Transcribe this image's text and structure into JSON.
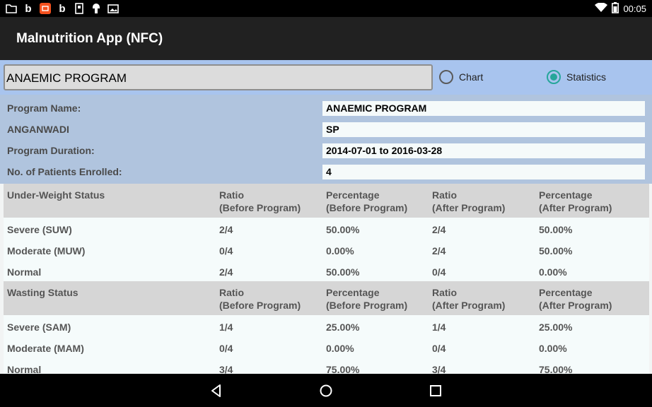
{
  "status_bar": {
    "left_icons": [
      "folder-icon",
      "b-app-icon",
      "notification-app-icon",
      "b-app-icon",
      "sim-icon",
      "android-debug-icon",
      "photos-icon"
    ],
    "time": "00:05",
    "right_icons": [
      "wifi-icon",
      "battery-icon"
    ]
  },
  "app_bar": {
    "title": "Malnutrition App (NFC)"
  },
  "controls": {
    "program_value": "ANAEMIC PROGRAM",
    "radio_chart": "Chart",
    "radio_statistics": "Statistics",
    "selected": "Statistics",
    "accent_color": "#26a69a"
  },
  "info": [
    {
      "label": "Program Name:",
      "value": "ANAEMIC PROGRAM"
    },
    {
      "label": "ANGANWADI",
      "value": "SP"
    },
    {
      "label": "Program Duration:",
      "value": "2014-07-01 to 2016-03-28"
    },
    {
      "label": "No. of Patients Enrolled:",
      "value": "4"
    }
  ],
  "sections": [
    {
      "header": [
        "Under-Weight Status",
        "Ratio\n(Before Program)",
        "Percentage\n(Before Program)",
        "Ratio\n(After Program)",
        "Percentage\n(After Program)"
      ],
      "rows": [
        [
          "Severe (SUW)",
          "2/4",
          "50.00%",
          "2/4",
          "50.00%"
        ],
        [
          "Moderate (MUW)",
          "0/4",
          "0.00%",
          "2/4",
          "50.00%"
        ],
        [
          "Normal",
          "2/4",
          "50.00%",
          "0/4",
          "0.00%"
        ]
      ]
    },
    {
      "header": [
        "Wasting Status",
        "Ratio\n(Before Program)",
        "Percentage\n(Before Program)",
        "Ratio\n(After Program)",
        "Percentage\n(After Program)"
      ],
      "rows": [
        [
          "Severe (SAM)",
          "1/4",
          "25.00%",
          "1/4",
          "25.00%"
        ],
        [
          "Moderate (MAM)",
          "0/4",
          "0.00%",
          "0/4",
          "0.00%"
        ],
        [
          "Normal",
          "3/4",
          "75.00%",
          "3/4",
          "75.00%"
        ]
      ]
    }
  ],
  "nav": {
    "icons": [
      "back-icon",
      "home-icon",
      "recents-icon"
    ]
  }
}
